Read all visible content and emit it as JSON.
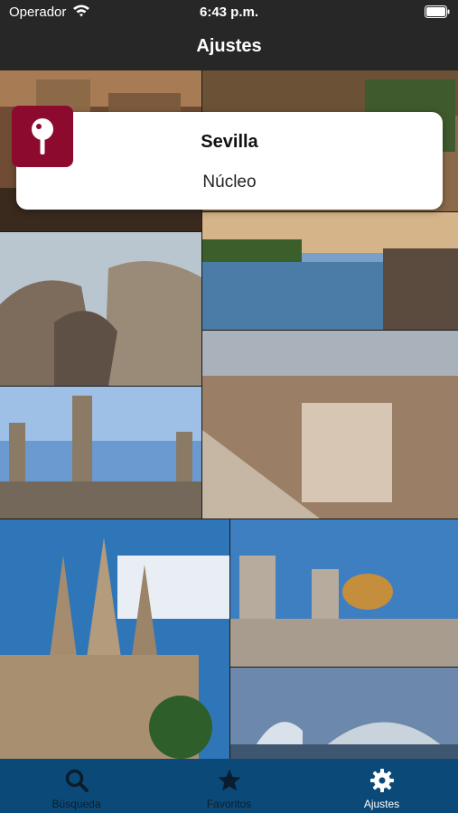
{
  "status_bar": {
    "carrier": "Operador",
    "time": "6:43 p.m."
  },
  "nav": {
    "title": "Ajustes"
  },
  "card": {
    "city": "Sevilla",
    "subtitle": "Núcleo"
  },
  "tabs": [
    {
      "label": "Búsqueda",
      "icon": "search-icon",
      "active": false
    },
    {
      "label": "Favoritos",
      "icon": "star-icon",
      "active": false
    },
    {
      "label": "Ajustes",
      "icon": "gear-icon",
      "active": true
    }
  ],
  "colors": {
    "accent": "#8b0a2d",
    "tab_bar": "#0b4a78",
    "tab_active": "#ffffff",
    "tab_inactive": "#0a1d2e"
  }
}
